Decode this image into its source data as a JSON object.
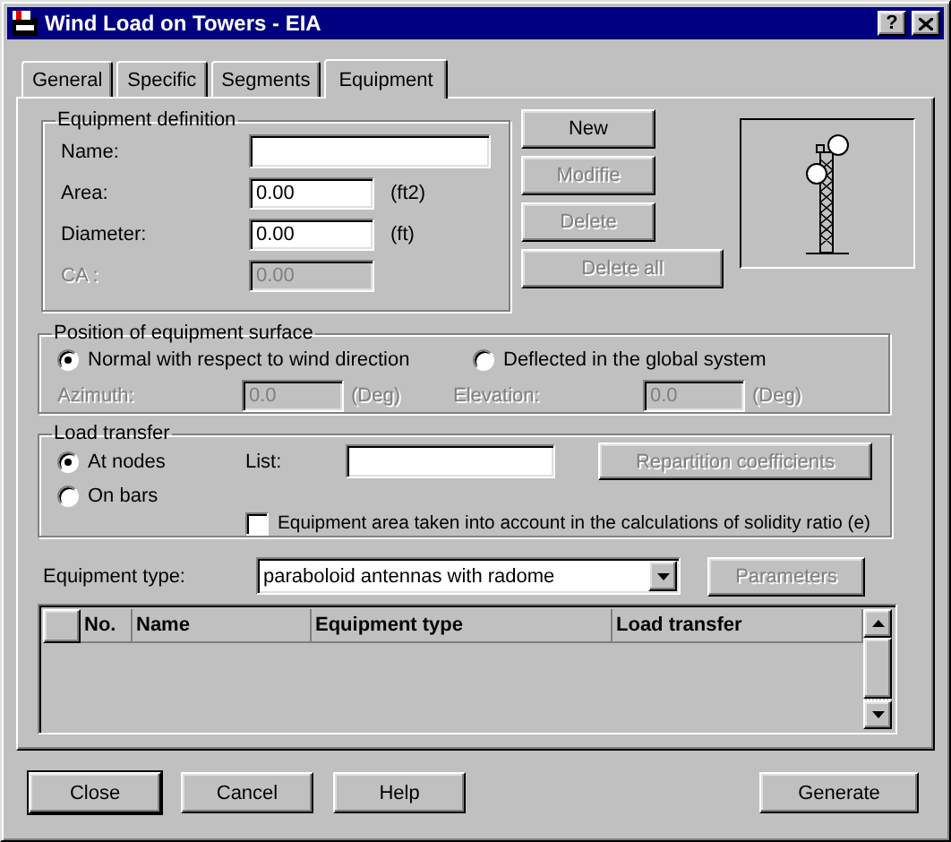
{
  "window": {
    "title": "Wind Load on Towers - EIA",
    "help_button": "?"
  },
  "tabs": [
    {
      "label": "General",
      "selected": false
    },
    {
      "label": "Specific",
      "selected": false
    },
    {
      "label": "Segments",
      "selected": false
    },
    {
      "label": "Equipment",
      "selected": true
    }
  ],
  "equipment_definition": {
    "title": "Equipment definition",
    "fields": [
      {
        "label": "Name:",
        "disabled": false
      },
      {
        "label": "Area:",
        "value": "0.00",
        "unit": "(ft2)",
        "disabled": false
      },
      {
        "label": "Diameter:",
        "value": "0.00",
        "unit": "(ft)",
        "disabled": false
      },
      {
        "label": "CA :",
        "value": "0.00",
        "disabled": true
      }
    ]
  },
  "equipment_buttons": [
    {
      "label": "New",
      "disabled": false
    },
    {
      "label": "Modifie",
      "disabled": true
    },
    {
      "label": "Delete",
      "disabled": true
    },
    {
      "label": "Delete all",
      "disabled": true
    }
  ],
  "position": {
    "title": "Position of equipment surface",
    "options": [
      {
        "label": "Normal with respect to wind direction",
        "selected": true
      },
      {
        "label": "Deflected in the global system",
        "selected": false
      }
    ],
    "angles": [
      {
        "label": "Azimuth:",
        "value": "0.0",
        "unit": "(Deg)",
        "disabled": true
      },
      {
        "label": "Elevation:",
        "value": "0.0",
        "unit": "(Deg)",
        "disabled": true
      }
    ]
  },
  "load_transfer": {
    "title": "Load transfer",
    "options": [
      {
        "label": "At nodes",
        "selected": true
      },
      {
        "label": "On bars",
        "selected": false
      }
    ],
    "list_label": "List:",
    "repartition_button": {
      "label": "Repartition coefficients",
      "disabled": true
    },
    "solidity_checkbox": {
      "label": "Equipment area taken into account in the calculations of solidity ratio (e)",
      "checked": false
    }
  },
  "equipment_type": {
    "label": "Equipment type:",
    "value": "paraboloid antennas with radome"
  },
  "parameters_button": {
    "label": "Parameters",
    "disabled": true
  },
  "table": {
    "columns": [
      "No.",
      "Name",
      "Equipment type",
      "Load transfer"
    ]
  },
  "footer_buttons": [
    {
      "label": "Close",
      "default": true
    },
    {
      "label": "Cancel",
      "default": false
    },
    {
      "label": "Help",
      "default": false
    },
    {
      "label": "Generate",
      "default": false
    }
  ]
}
